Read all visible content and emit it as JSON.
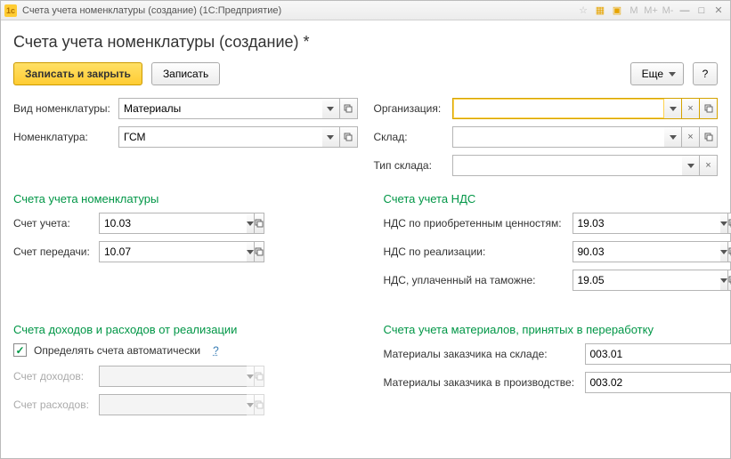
{
  "window": {
    "title": "Счета учета номенклатуры (создание)  (1С:Предприятие)",
    "page_title": "Счета учета номенклатуры (создание) *",
    "more_label": "Еще",
    "help_label": "?"
  },
  "toolbar": {
    "save_close": "Записать и закрыть",
    "save": "Записать"
  },
  "left": {
    "nomenclature_type_label": "Вид номенклатуры:",
    "nomenclature_type_value": "Материалы",
    "nomenclature_label": "Номенклатура:",
    "nomenclature_value": "ГСМ"
  },
  "right": {
    "org_label": "Организация:",
    "org_value": "",
    "warehouse_label": "Склад:",
    "warehouse_value": "",
    "warehouse_type_label": "Тип склада:",
    "warehouse_type_value": ""
  },
  "sections": {
    "accounts_title": "Счета учета номенклатуры",
    "account_label": "Счет учета:",
    "account_value": "10.03",
    "transfer_label": "Счет передачи:",
    "transfer_value": "10.07",
    "vat_title": "Счета учета НДС",
    "vat_acq_label": "НДС по приобретенным ценностям:",
    "vat_acq_value": "19.03",
    "vat_real_label": "НДС по реализации:",
    "vat_real_value": "90.03",
    "vat_cust_label": "НДС, уплаченный на таможне:",
    "vat_cust_value": "19.05",
    "income_title": "Счета доходов и расходов от реализации",
    "auto_chk_label": "Определять счета автоматически",
    "income_label": "Счет доходов:",
    "expense_label": "Счет расходов:",
    "materials_title": "Счета учета материалов, принятых в переработку",
    "mat_wh_label": "Материалы заказчика на складе:",
    "mat_wh_value": "003.01",
    "mat_prod_label": "Материалы заказчика в производстве:",
    "mat_prod_value": "003.02"
  },
  "titlebar_icons": {
    "m": "M",
    "mplus": "M+",
    "mminus": "M-",
    "minus": "—",
    "close": "✕"
  }
}
